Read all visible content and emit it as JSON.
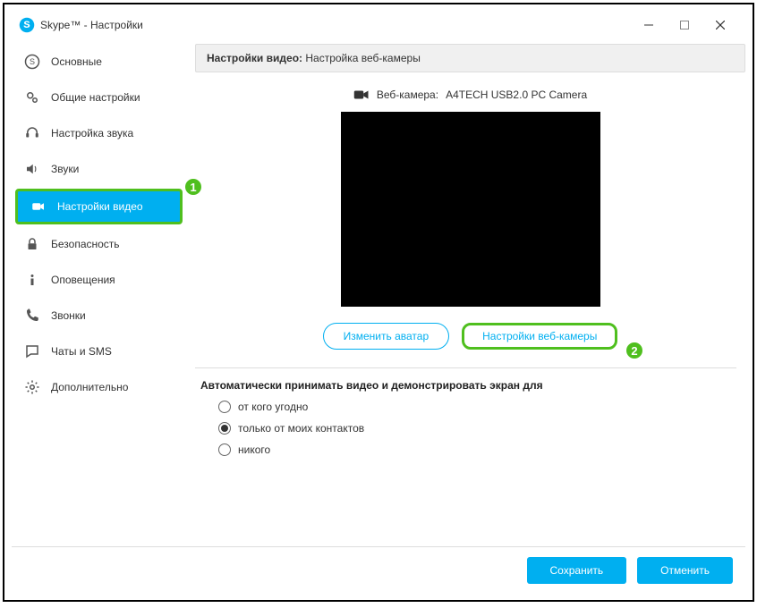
{
  "window": {
    "title": "Skype™ - Настройки"
  },
  "sidebar": {
    "items": [
      {
        "label": "Основные"
      },
      {
        "label": "Общие настройки"
      },
      {
        "label": "Настройка звука"
      },
      {
        "label": "Звуки"
      },
      {
        "label": "Настройки видео"
      },
      {
        "label": "Безопасность"
      },
      {
        "label": "Оповещения"
      },
      {
        "label": "Звонки"
      },
      {
        "label": "Чаты и SMS"
      },
      {
        "label": "Дополнительно"
      }
    ]
  },
  "panel": {
    "header_prefix": "Настройки видео:",
    "header_text": "Настройка веб-камеры",
    "camera_label": "Веб-камера:",
    "camera_name": "A4TECH USB2.0 PC Camera",
    "change_avatar": "Изменить аватар",
    "webcam_settings": "Настройки веб-камеры",
    "auto_accept_label": "Автоматически принимать видео и демонстрировать экран для",
    "radio_anyone": "от кого угодно",
    "radio_contacts": "только от моих контактов",
    "radio_nobody": "никого"
  },
  "footer": {
    "save": "Сохранить",
    "cancel": "Отменить"
  },
  "badges": {
    "one": "1",
    "two": "2"
  }
}
